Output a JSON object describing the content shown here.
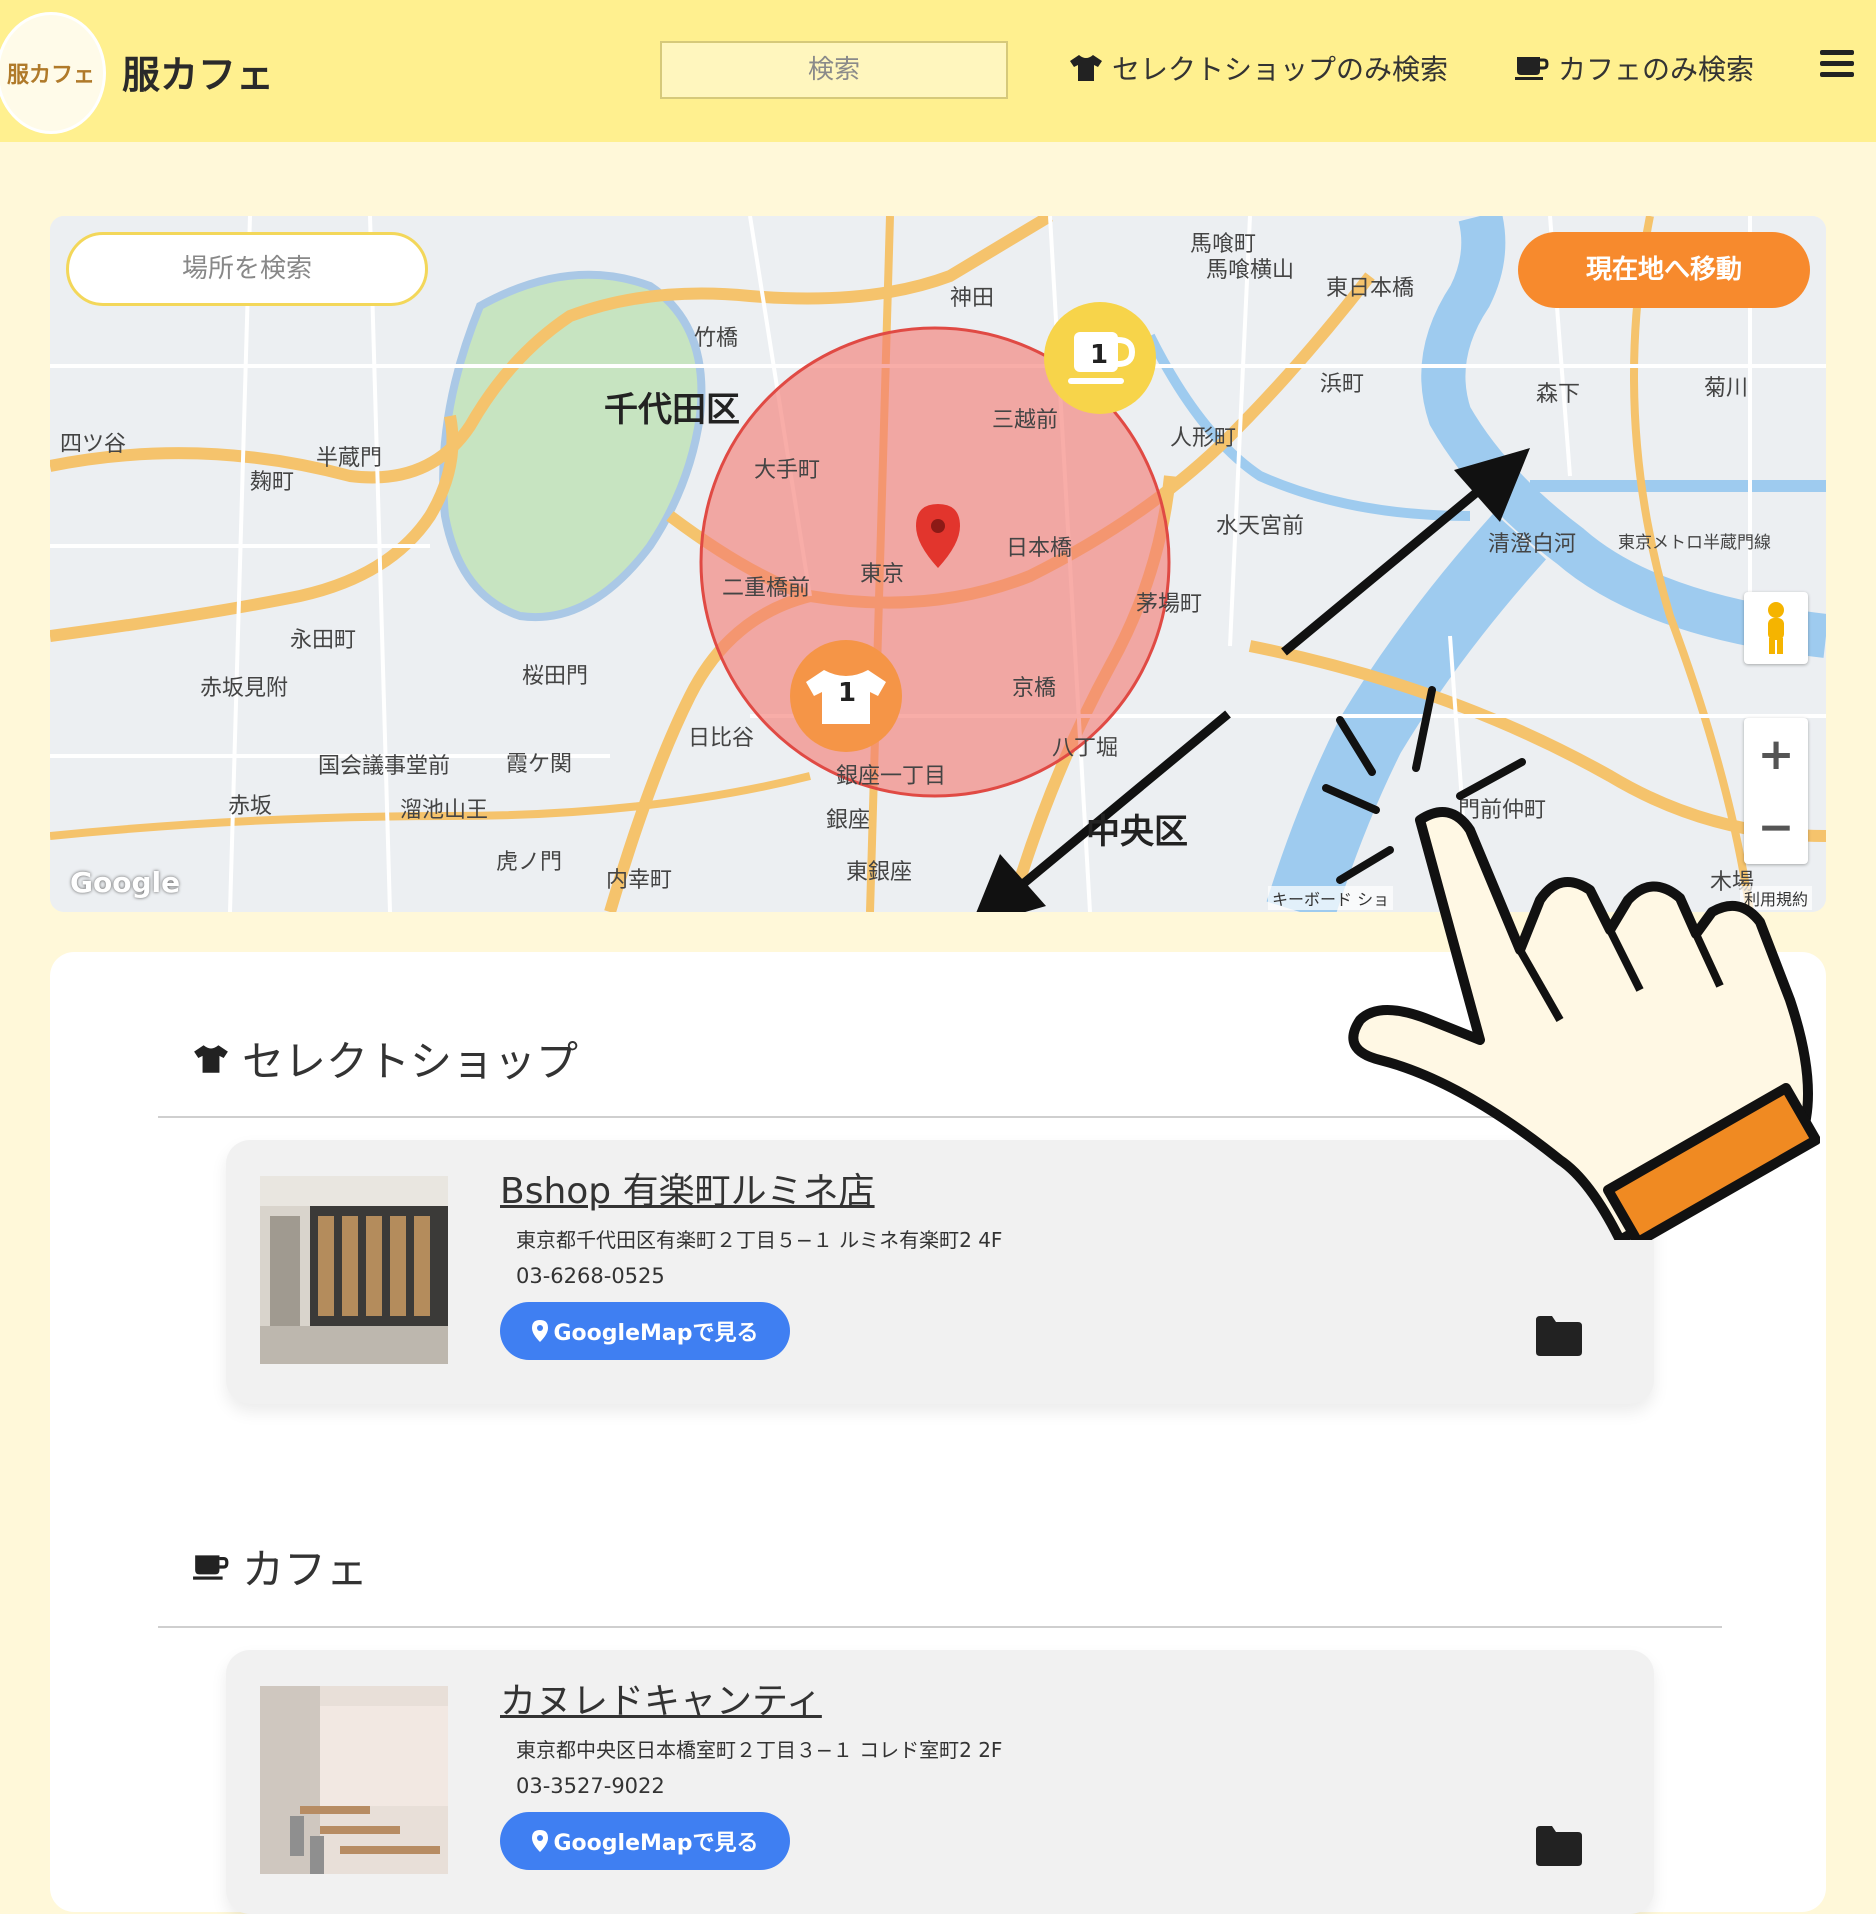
{
  "header": {
    "logo_text": "服カフェ",
    "brand": "服カフェ",
    "search_placeholder": "検索",
    "nav_shop": "セレクトショップのみ検索",
    "nav_cafe": "カフェのみ検索"
  },
  "map": {
    "place_search_placeholder": "場所を検索",
    "current_location_button": "現在地へ移動",
    "zoom_in": "+",
    "zoom_out": "−",
    "google_mark": "Google",
    "keyboard_shortcuts": "キーボード ショ",
    "terms": "利用規約",
    "cafe_marker_count": "1",
    "shop_marker_count": "1",
    "labels": {
      "chiyoda": "千代田区",
      "chuo": "中央区",
      "kanda": "神田",
      "tokyo": "東京",
      "otemachi": "大手町",
      "nihonbashi": "日本橋",
      "mitsukoshimae": "三越前",
      "ningyocho": "人形町",
      "kayabacho": "茅場町",
      "suitengumae": "水天宮前",
      "hibiya": "日比谷",
      "ginza": "銀座",
      "higashiginza": "東銀座",
      "ginza1": "銀座一丁目",
      "kyobashi": "京橋",
      "hatchobori": "八丁堀",
      "nijubashimae": "二重橋前",
      "sakuradamon": "桜田門",
      "kasumigaseki": "霞ケ関",
      "kokkaigijidomae": "国会議事堂前",
      "tameikesanno": "溜池山王",
      "akasaka": "赤坂",
      "akasakamitsuke": "赤坂見附",
      "nagatacho": "永田町",
      "hanzomon": "半蔵門",
      "kojimachi": "麹町",
      "yotsuya": "四ツ谷",
      "takebashi": "竹橋",
      "bakurocho": "馬喰町",
      "bakuroyokoyama": "馬喰横山",
      "higashinihonbashi": "東日本橋",
      "hamacho": "浜町",
      "morishita": "森下",
      "kikukawa": "菊川",
      "kiyosumishirakawa": "清澄白河",
      "monzennakacho": "門前仲町",
      "kiba": "木場",
      "uchisaiwaicho": "内幸町",
      "toranomon": "虎ノ門",
      "hanzomonline": "東京メトロ半蔵門線"
    }
  },
  "list": {
    "shop_section_title": "セレクトショップ",
    "cafe_section_title": "カフェ",
    "shops": [
      {
        "name": "Bshop 有楽町ルミネ店",
        "address": "東京都千代田区有楽町２丁目５−１ ルミネ有楽町2 4F",
        "tel": "03-6268-0525",
        "button": "GoogleMapで見る"
      }
    ],
    "cafes": [
      {
        "name": "カヌレドキャンティ",
        "address": "東京都中央区日本橋室町２丁目３−１ コレド室町2 2F",
        "tel": "03-3527-9022",
        "button": "GoogleMapで見る"
      }
    ]
  },
  "colors": {
    "header_bg": "#fff08f",
    "page_bg": "#fff8d9",
    "accent_orange": "#f78a2d",
    "button_blue": "#3f7ff2",
    "radius_fill": "#f47a72"
  },
  "icons": [
    "shirt-icon",
    "coffee-cup-icon",
    "menu-icon",
    "map-pin-icon",
    "folder-icon",
    "pegman-icon",
    "pointing-hand-icon"
  ]
}
